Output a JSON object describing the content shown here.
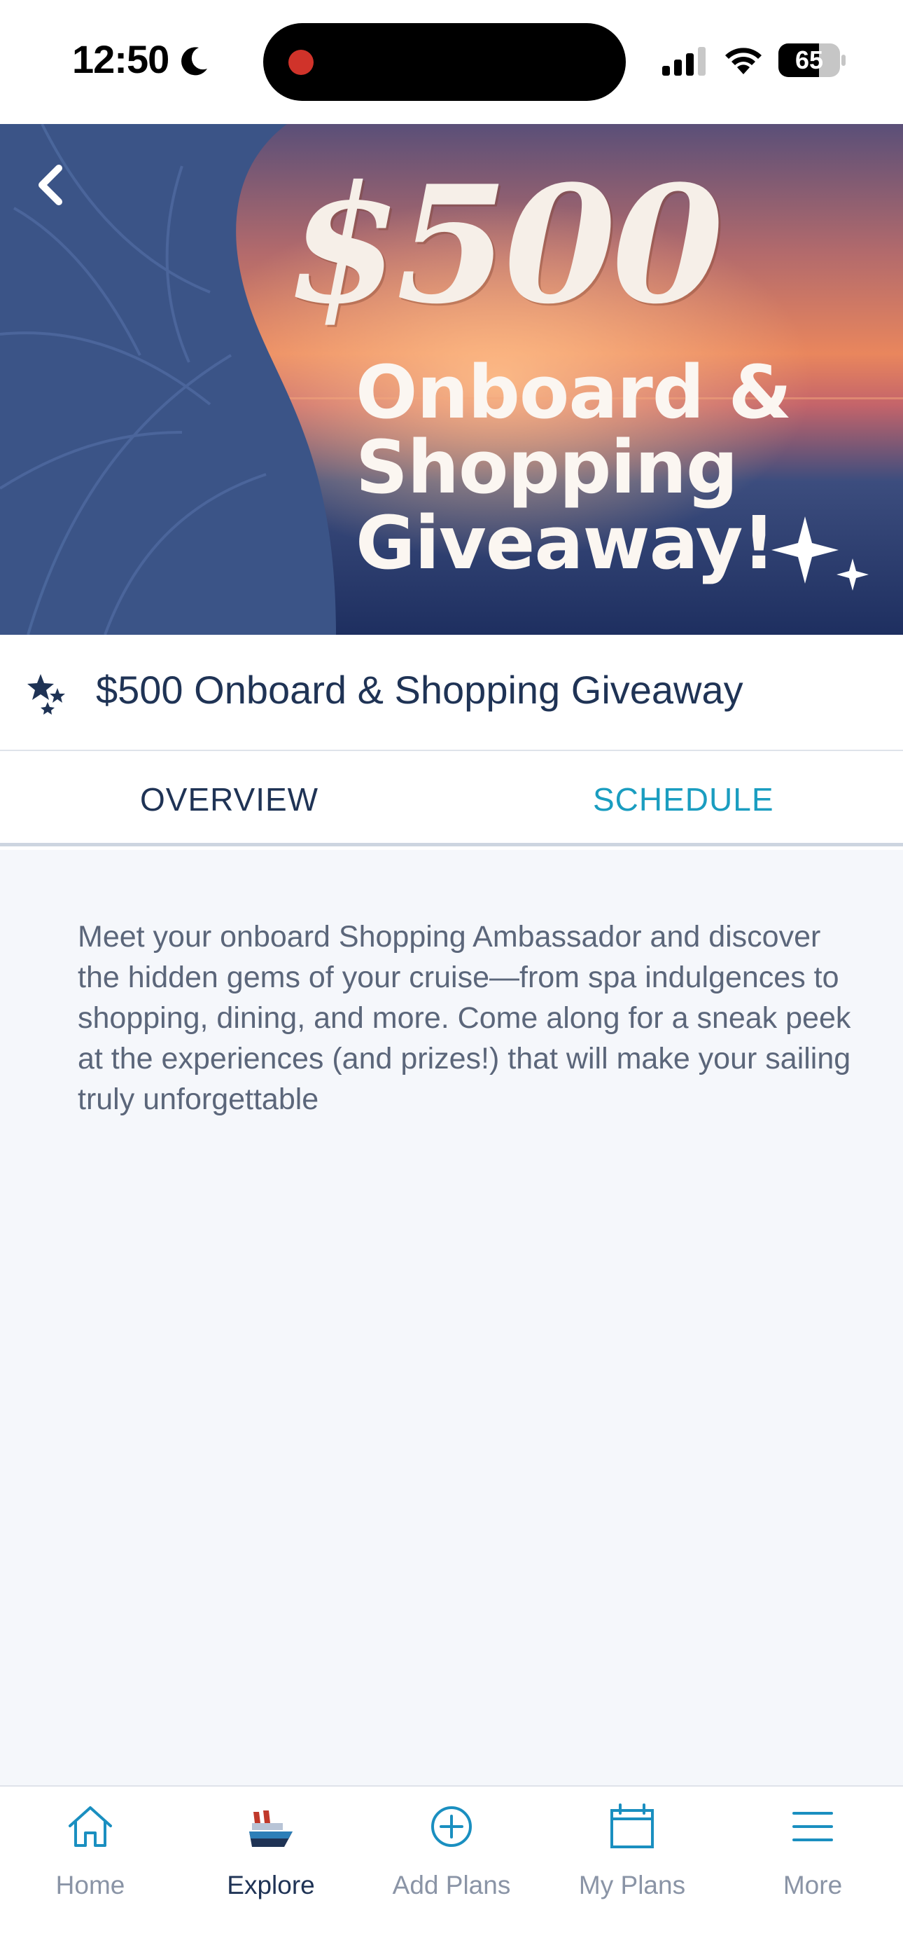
{
  "status_bar": {
    "time": "12:50",
    "battery": "65"
  },
  "hero": {
    "promo_amount": "$500",
    "promo_lines": [
      "Onboard &",
      "Shopping",
      "Giveaway!"
    ]
  },
  "event": {
    "title": "$500 Onboard & Shopping Giveaway"
  },
  "tabs": [
    {
      "label": "OVERVIEW",
      "active": false
    },
    {
      "label": "SCHEDULE",
      "active": true
    }
  ],
  "overview": {
    "description": "Meet your onboard Shopping Ambassador and discover the hidden gems of your cruise—from spa indulgences to shopping, dining, and more. Come along for a sneak peek at the experiences (and prizes!) that will make your sailing truly unforgettable"
  },
  "bottom_nav": [
    {
      "label": "Home",
      "icon": "home-icon"
    },
    {
      "label": "Explore",
      "icon": "ship-icon",
      "active": true
    },
    {
      "label": "Add Plans",
      "icon": "plus-circle-icon"
    },
    {
      "label": "My Plans",
      "icon": "calendar-icon"
    },
    {
      "label": "More",
      "icon": "menu-icon"
    }
  ],
  "colors": {
    "navy": "#1f3355",
    "accent_teal": "#1a9dc0",
    "content_bg": "#f5f7fb",
    "record_red": "#d0332a"
  }
}
